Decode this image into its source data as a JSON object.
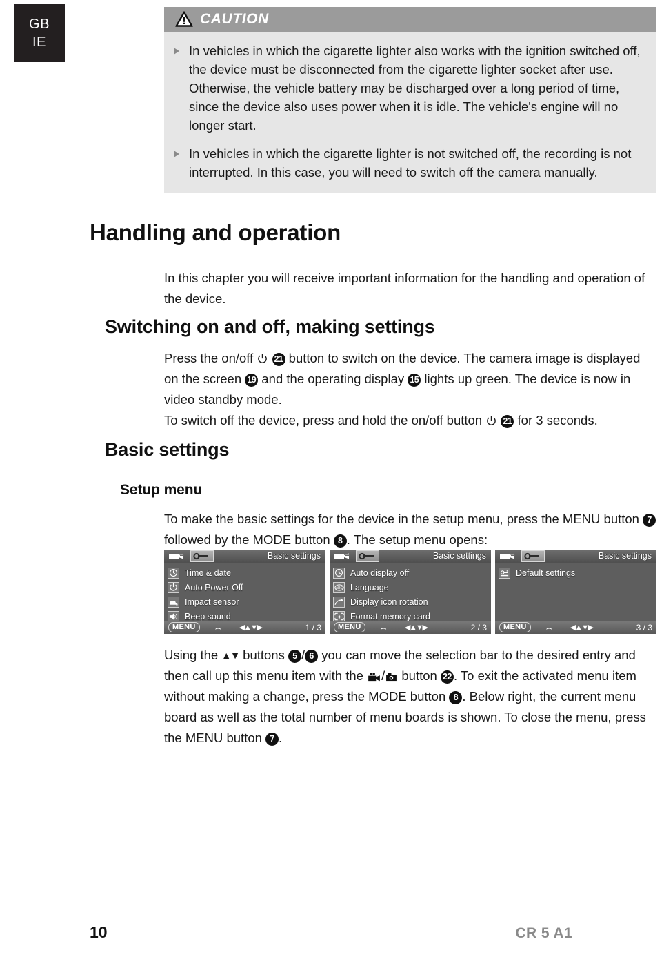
{
  "country_tab": {
    "line1": "GB",
    "line2": "IE"
  },
  "caution": {
    "title": "CAUTION",
    "icon": "warning-triangle-icon",
    "items": [
      "In vehicles in which the cigarette lighter also works with the ignition switched off, the device must be disconnected from the cigarette lighter socket after use. Otherwise, the vehicle battery may be discharged over a long period of time, since the device also uses power when it is idle. The vehicle's engine will no longer start.",
      "In vehicles in which the cigarette lighter is not switched off, the recording is not interrupted. In this case, you will need to switch off the camera manually."
    ]
  },
  "sections": {
    "handling_heading": "Handling and operation",
    "handling_intro": "In this chapter you will receive important information for the handling and operation of the device.",
    "switching_heading": "Switching on and off, making settings",
    "switching_p1_a": "Press the on/off",
    "switching_p1_badge1": "21",
    "switching_p1_b": "button to switch on the device. The camera image is displayed on the screen",
    "switching_p1_badge2": "19",
    "switching_p1_c": "and the operating display",
    "switching_p1_badge3": "15",
    "switching_p1_d": "lights up green. The device is now in video standby mode.",
    "switching_p2_a": "To switch off the device, press and hold the on/off button",
    "switching_p2_badge": "21",
    "switching_p2_b": "for 3 seconds.",
    "basic_settings_heading": "Basic settings",
    "setup_menu_heading": "Setup menu",
    "setup_p_a": "To make the basic settings for the device in the setup menu, press the MENU button",
    "setup_p_badge1": "7",
    "setup_p_b": "followed by the MODE button",
    "setup_p_badge2": "8",
    "setup_p_c": ". The setup menu opens:",
    "closing_p_a": "Using the",
    "closing_arrows": "▲▼",
    "closing_p_b": "buttons",
    "closing_badge1": "5",
    "closing_slash1": "/",
    "closing_badge2": "6",
    "closing_p_c": "you can move the selection bar to the desired entry and then call up this menu item with the",
    "closing_slash2": "/",
    "closing_p_d": "button",
    "closing_badge3": "22",
    "closing_p_e": ". To exit the activated menu item without making a change, press the MODE button",
    "closing_badge4": "8",
    "closing_p_f": ". Below right, the current menu board as well as the total number of menu boards is shown. To close the menu, press the MENU button",
    "closing_badge5": "7",
    "closing_p_g": "."
  },
  "menu_screens": [
    {
      "title": "Basic settings",
      "tabs": [
        {
          "icon": "camcorder-icon",
          "selected": false
        },
        {
          "icon": "wrench-icon",
          "selected": true
        }
      ],
      "items": [
        {
          "icon": "clock-icon",
          "label": "Time & date"
        },
        {
          "icon": "power-icon",
          "label": "Auto Power Off"
        },
        {
          "icon": "impact-sensor-icon",
          "label": "Impact sensor"
        },
        {
          "icon": "speaker-icon",
          "label": "Beep sound"
        }
      ],
      "menu_label": "MENU",
      "back_glyph": "back-arrow-icon",
      "dir_glyph": "dpad-arrows-icon",
      "page": "1 / 3"
    },
    {
      "title": "Basic settings",
      "tabs": [
        {
          "icon": "camcorder-icon",
          "selected": false
        },
        {
          "icon": "wrench-icon",
          "selected": true
        }
      ],
      "items": [
        {
          "icon": "clock-icon",
          "label": "Auto display off"
        },
        {
          "icon": "abc-language-icon",
          "label": "Language"
        },
        {
          "icon": "rotate-icon",
          "label": "Display icon rotation"
        },
        {
          "icon": "format-card-icon",
          "label": "Format memory card"
        }
      ],
      "menu_label": "MENU",
      "back_glyph": "back-arrow-icon",
      "dir_glyph": "dpad-arrows-icon",
      "page": "2 / 3"
    },
    {
      "title": "Basic settings",
      "tabs": [
        {
          "icon": "camcorder-icon",
          "selected": false
        },
        {
          "icon": "wrench-icon",
          "selected": true
        }
      ],
      "items": [
        {
          "icon": "default-settings-icon",
          "label": "Default settings"
        }
      ],
      "menu_label": "MENU",
      "back_glyph": "back-arrow-icon",
      "dir_glyph": "dpad-arrows-icon",
      "page": "3 / 3"
    }
  ],
  "footer": {
    "page_number": "10",
    "model": "CR 5 A1"
  },
  "colors": {
    "caution_header_bg": "#9b9b9b",
    "caution_body_bg": "#e6e6e6",
    "tab_bg": "#231f20",
    "menu_bg": "#5e5e5e",
    "model_text": "#8a8a8a"
  }
}
